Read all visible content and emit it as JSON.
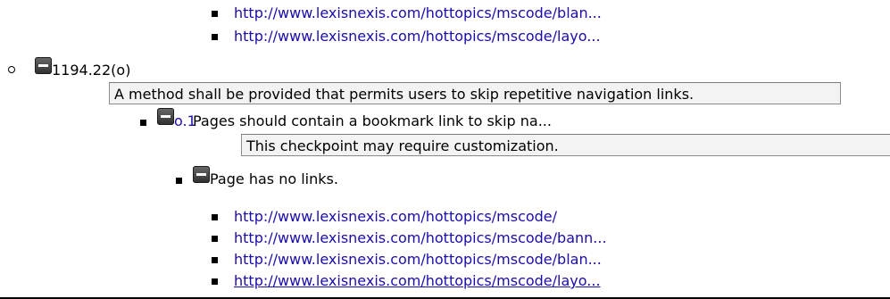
{
  "top_links": [
    "http://www.lexisnexis.com/hottopics/mscode/blan...",
    "http://www.lexisnexis.com/hottopics/mscode/layo..."
  ],
  "section": {
    "title": "1194.22(o)",
    "description": "A method shall be provided that permits users to skip repetitive navigation links."
  },
  "checkpoint": {
    "id_link": "o.1",
    "text": " Pages should contain a bookmark link to skip na...",
    "note": "This checkpoint may require customization."
  },
  "result": {
    "text": "Page has no links.",
    "links": [
      "http://www.lexisnexis.com/hottopics/mscode/",
      "http://www.lexisnexis.com/hottopics/mscode/bann...",
      "http://www.lexisnexis.com/hottopics/mscode/blan...",
      "http://www.lexisnexis.com/hottopics/mscode/layo..."
    ]
  }
}
